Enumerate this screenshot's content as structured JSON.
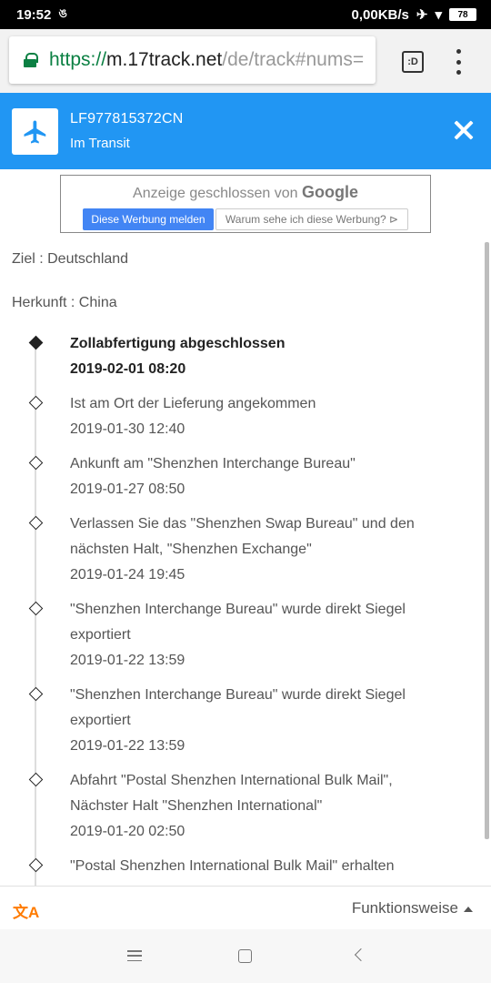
{
  "status_bar": {
    "time": "19:52",
    "network_speed": "0,00KB/s",
    "battery": "78"
  },
  "browser": {
    "url_scheme": "https://",
    "url_host": "m.17track.net",
    "url_path": "/de/track#nums=",
    "tab_count": ":D"
  },
  "header": {
    "icon": "airplane-icon",
    "tracking_number": "LF977815372CN",
    "status": "Im Transit",
    "bg_color": "#2196f3"
  },
  "ad": {
    "closed_text": "Anzeige geschlossen von",
    "brand": "Google",
    "report_button": "Diese Werbung melden",
    "why_button": "Warum sehe ich diese Werbung? ⊳"
  },
  "info": {
    "destination": "Ziel : Deutschland",
    "origin": "Herkunft : China"
  },
  "events": [
    {
      "desc": "Zollabfertigung abgeschlossen",
      "time": "2019-02-01 08:20",
      "latest": true
    },
    {
      "desc": "Ist am Ort der Lieferung angekommen",
      "time": "2019-01-30 12:40"
    },
    {
      "desc": "Ankunft am \"Shenzhen Interchange Bureau\"",
      "time": "2019-01-27 08:50"
    },
    {
      "desc": "Verlassen Sie das \"Shenzhen Swap Bureau\" und den nächsten Halt, \"Shenzhen Exchange\"",
      "time": "2019-01-24 19:45"
    },
    {
      "desc": "\"Shenzhen Interchange Bureau\" wurde direkt Siegel exportiert",
      "time": "2019-01-22 13:59"
    },
    {
      "desc": "\"Shenzhen Interchange Bureau\" wurde direkt Siegel exportiert",
      "time": "2019-01-22 13:59"
    },
    {
      "desc": "Abfahrt \"Postal Shenzhen International Bulk Mail\", Nächster Halt \"Shenzhen International\"",
      "time": "2019-01-20 02:50"
    },
    {
      "desc": "\"Postal Shenzhen International Bulk Mail\" erhalten",
      "time": ""
    }
  ],
  "footer": {
    "translate_icon": "文A",
    "howto_label": "Funktionsweise"
  }
}
